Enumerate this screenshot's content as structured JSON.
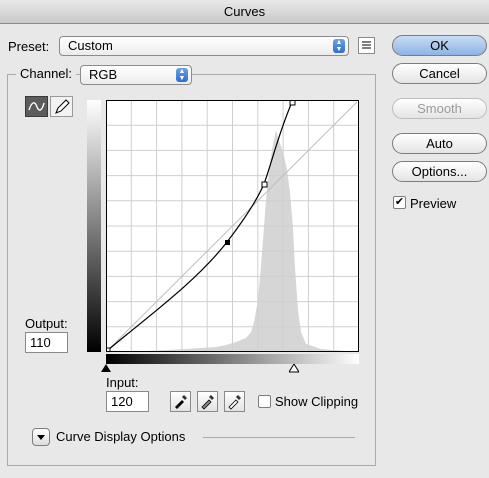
{
  "window": {
    "title": "Curves"
  },
  "preset": {
    "label": "Preset:",
    "value": "Custom"
  },
  "channel": {
    "label": "Channel:",
    "value": "RGB"
  },
  "buttons": {
    "ok": "OK",
    "cancel": "Cancel",
    "smooth": "Smooth",
    "auto": "Auto",
    "options": "Options..."
  },
  "preview": {
    "label": "Preview",
    "checked": true
  },
  "output": {
    "label": "Output:",
    "value": "110"
  },
  "input": {
    "label": "Input:",
    "value": "120"
  },
  "show_clipping": {
    "label": "Show Clipping",
    "checked": false
  },
  "curve_display_options": {
    "label": "Curve Display Options"
  },
  "icons": [
    "curve-point-tool-icon",
    "pencil-icon",
    "preset-options-icon",
    "black-eyedropper-icon",
    "gray-eyedropper-icon",
    "white-eyedropper-icon",
    "disclosure-triangle-icon"
  ],
  "colors": {
    "default_button": "#8db4e3",
    "histogram": "#d6d6d6",
    "curve": "#000000"
  }
}
